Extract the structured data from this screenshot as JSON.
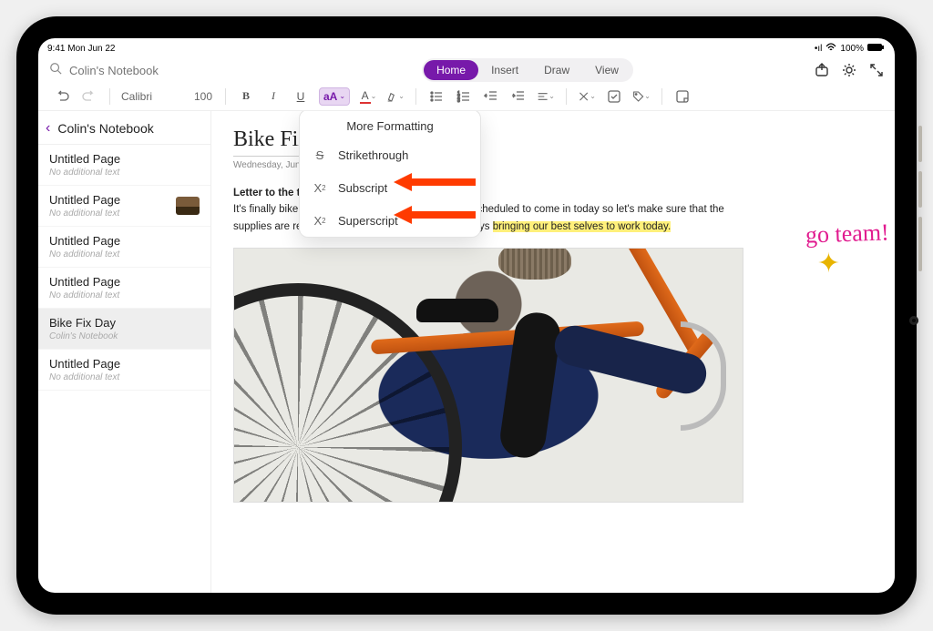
{
  "status": {
    "time_date": "9:41  Mon Jun 22",
    "battery": "100%"
  },
  "header": {
    "search_placeholder": "Colin's Notebook",
    "tabs": {
      "home": "Home",
      "insert": "Insert",
      "draw": "Draw",
      "view": "View"
    }
  },
  "toolbar": {
    "font_name": "Calibri",
    "font_size": "100"
  },
  "sidebar": {
    "title": "Colin's Notebook",
    "items": [
      {
        "title": "Untitled Page",
        "sub": "No additional text"
      },
      {
        "title": "Untitled Page",
        "sub": "No additional text"
      },
      {
        "title": "Untitled Page",
        "sub": "No additional text"
      },
      {
        "title": "Untitled Page",
        "sub": "No additional text"
      },
      {
        "title": "Bike Fix Day",
        "sub": "Colin's Notebook"
      },
      {
        "title": "Untitled Page",
        "sub": "No additional text"
      }
    ]
  },
  "page": {
    "title": "Bike Fix Day",
    "date_prefix": "Wednesday, June",
    "para_lead": "Letter to the team:",
    "para_body_1": "It's finally bike fix day! We've got a lot of customers scheduled to come in today so let's make sure that the supplies are ready in the back and that we're as always ",
    "para_hl": "bringing our best selves to work today.",
    "handnote": "go team!"
  },
  "dropdown": {
    "title": "More Formatting",
    "items": {
      "strike": "Strikethrough",
      "sub": "Subscript",
      "sup": "Superscript"
    }
  }
}
